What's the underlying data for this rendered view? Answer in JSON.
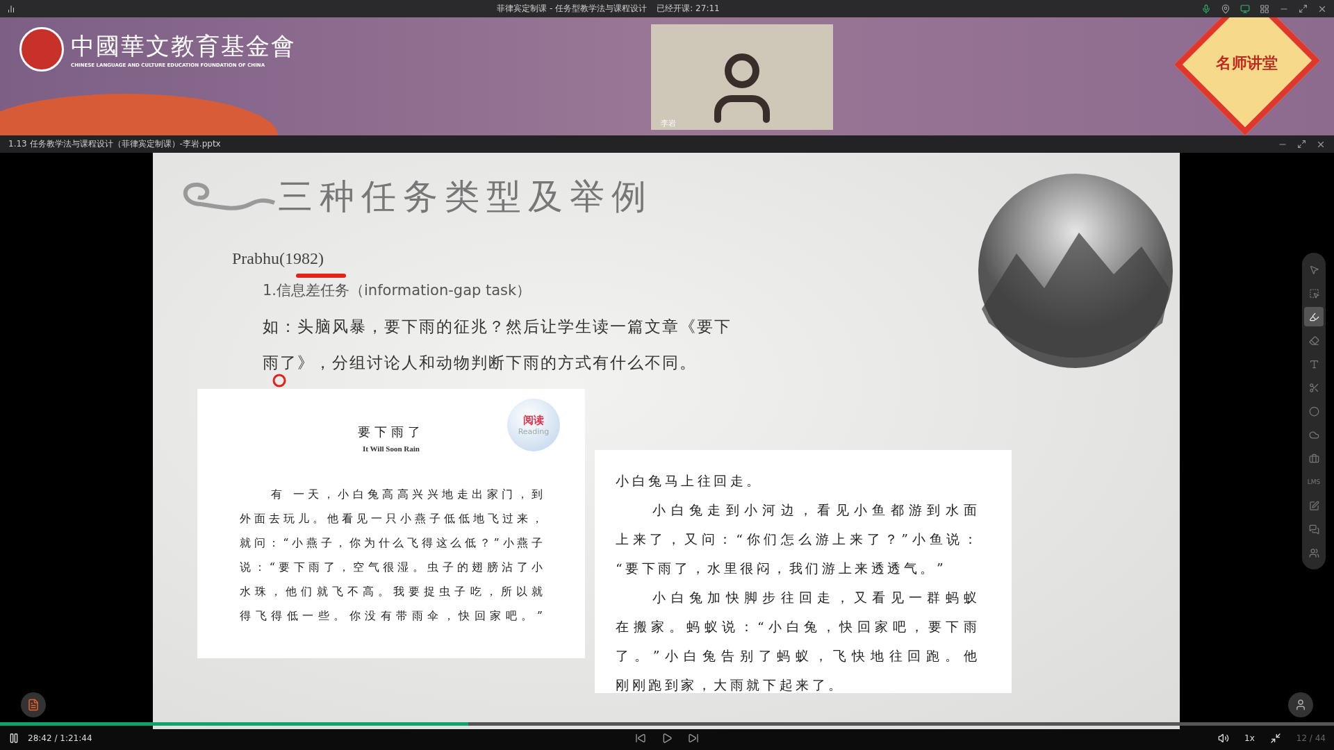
{
  "title_bar": {
    "title": "菲律宾定制课 - 任务型教学法与课程设计",
    "elapsed_label": "已经开课: 27:11"
  },
  "header": {
    "logo_name": "中國華文教育基金會",
    "logo_subtitle": "CHINESE LANGUAGE AND CULTURE EDUCATION FOUNDATION OF CHINA",
    "speaker_name": "李岩",
    "badge": "名师讲堂"
  },
  "file_bar": {
    "filename": "1.13 任务教学法与课程设计（菲律宾定制课）-李岩.pptx"
  },
  "slide": {
    "title": "三种任务类型及举例",
    "author": "Prabhu(1982)",
    "item": "1.信息差任务（information-gap task）",
    "example_lines": [
      "如：头脑风暴，要下雨的征兆？然后让学生读一篇文章《要下",
      "雨了》，分组讨论人和动物判断下雨的方式有什么不同。"
    ],
    "left_panel": {
      "badge_label": "阅读",
      "badge_sub": "Reading",
      "title": "要下雨了",
      "subtitle": "It Will Soon Rain",
      "lines": [
        {
          "text": "有 一天，小白兔高高兴兴地走出家门，到",
          "indent": true,
          "kind": "full"
        },
        {
          "text": "外面去玩儿。他看见一只小燕子低低地飞过来，",
          "indent": false,
          "kind": "full"
        },
        {
          "text": "就问：“小燕子，你为什么飞得这么低？”小燕子",
          "indent": false,
          "kind": "full"
        },
        {
          "text": "说：“要下雨了，空气很湿。虫子的翅膀沾了小",
          "indent": false,
          "kind": "full"
        },
        {
          "text": "水珠，他们就飞不高。我要捉虫子吃，所以就",
          "indent": false,
          "kind": "full"
        },
        {
          "text": "得飞得低一些。你没有带雨伞，快回家吧。”",
          "indent": false,
          "kind": "full"
        }
      ]
    },
    "right_panel": {
      "lines": [
        {
          "text": "小白兔马上往回走。",
          "indent": false,
          "kind": "short"
        },
        {
          "text": "小白兔走到小河边，看见小鱼都游到水面",
          "indent": true,
          "kind": "full"
        },
        {
          "text": "上来了，又问：“你们怎么游上来了？”小鱼说：",
          "indent": false,
          "kind": "full"
        },
        {
          "text": "“要下雨了，水里很闷，我们游上来透透气。”",
          "indent": false,
          "kind": "short"
        },
        {
          "text": "小白兔加快脚步往回走，又看见一群蚂蚁",
          "indent": true,
          "kind": "full"
        },
        {
          "text": "在搬家。蚂蚁说：“小白兔，快回家吧，要下雨",
          "indent": false,
          "kind": "full"
        },
        {
          "text": "了。”小白兔告别了蚂蚁，飞快地往回跑。他",
          "indent": false,
          "kind": "full"
        },
        {
          "text": "刚刚跑到家，大雨就下起来了。",
          "indent": false,
          "kind": "short"
        }
      ]
    }
  },
  "tools": [
    {
      "selected": false
    },
    {
      "selected": false
    },
    {
      "selected": true
    },
    {
      "selected": false
    },
    {
      "selected": false
    },
    {
      "selected": false
    },
    {
      "selected": false
    },
    {
      "selected": false
    },
    {
      "selected": false
    },
    {
      "label": "LMS",
      "selected": false
    },
    {
      "selected": false
    },
    {
      "selected": false
    },
    {
      "selected": false
    }
  ],
  "player": {
    "level": 0.351,
    "time": "28:42 / 1:21:44",
    "speed": "1x",
    "page": "12 / 44",
    "playing": true
  }
}
